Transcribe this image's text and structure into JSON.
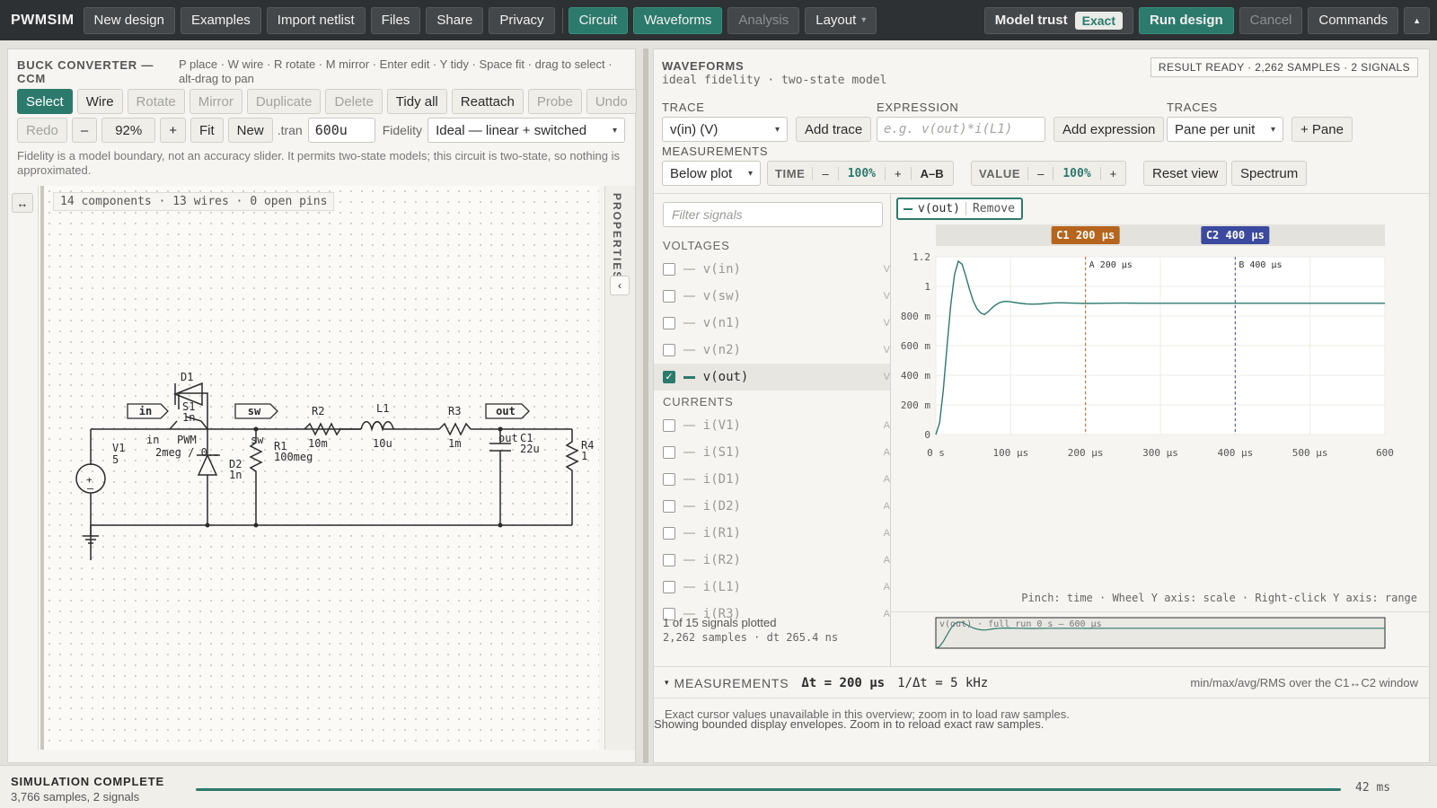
{
  "app": {
    "brand": "PWMSIM",
    "toolbar": {
      "new_design": "New design",
      "examples": "Examples",
      "import_netlist": "Import netlist",
      "files": "Files",
      "share": "Share",
      "privacy": "Privacy",
      "circuit": "Circuit",
      "waveforms": "Waveforms",
      "analysis": "Analysis",
      "layout": "Layout",
      "model_trust": "Model trust",
      "model_trust_value": "Exact",
      "run_design": "Run design",
      "cancel": "Cancel",
      "commands": "Commands"
    },
    "accent_color": "#2c7a6c"
  },
  "editor": {
    "title": "BUCK CONVERTER — CCM",
    "hint": "P place · W wire · R rotate · M mirror · Enter edit · Y tidy · Space fit · drag to select · alt-drag to pan",
    "tools": [
      "Select",
      "Wire",
      "Rotate",
      "Mirror",
      "Duplicate",
      "Delete",
      "Tidy all",
      "Reattach",
      "Probe",
      "Undo"
    ],
    "redo": "Redo",
    "zoom_minus": "–",
    "zoom": "92%",
    "zoom_plus": "+",
    "fit": "Fit",
    "new": "New",
    "tran_label": ".tran",
    "tran_value": "600u",
    "fidelity_label": "Fidelity",
    "fidelity_value": "Ideal — linear + switched",
    "fidelity_note": "Fidelity is a model boundary, not an accuracy slider. It permits two-state models; this circuit is two-state, so nothing is approximated.",
    "counts": "14 components · 13 wires · 0 open pins",
    "properties": "PROPERTIES",
    "expand_icon": "↔",
    "collapse_icon": "‹",
    "schematic": {
      "v1_name": "V1",
      "v1_value": "5",
      "s1_name": "S1",
      "s1_value": "1n",
      "pwm_name": "PWM",
      "pwm_value": "2meg / 0.…",
      "d1_name": "D1",
      "d2_name": "D2",
      "d2_value": "1n",
      "r1_name": "R1",
      "r1_value": "100meg",
      "r2_name": "R2",
      "r2_value": "10m",
      "l1_name": "L1",
      "l1_value": "10u",
      "r3_name": "R3",
      "r3_value": "1m",
      "c1_name": "C1",
      "c1_value": "22u",
      "r4_name": "R4",
      "r4_value": "1",
      "net_in": "in",
      "net_sw": "sw",
      "net_out": "out"
    }
  },
  "waveforms": {
    "title": "WAVEFORMS",
    "subtitle": "ideal fidelity · two-state model",
    "result_badge": "RESULT READY · 2,262 SAMPLES · 2 SIGNALS",
    "trace_label": "TRACE",
    "trace_value": "v(in) (V)",
    "add_trace": "Add trace",
    "expression_label": "EXPRESSION",
    "expression_placeholder": "e.g. v(out)*i(L1)",
    "add_expression": "Add expression",
    "traces_label": "TRACES",
    "traces_value": "Pane per unit",
    "add_pane": "+ Pane",
    "measurements_label": "MEASUREMENTS",
    "measurements_value": "Below plot",
    "time_label": "TIME",
    "time_zoom": "100%",
    "ab": "A–B",
    "value_label": "VALUE",
    "value_zoom": "100%",
    "minus": "–",
    "plus": "+",
    "reset_view": "Reset view",
    "spectrum": "Spectrum",
    "filter_placeholder": "Filter signals",
    "voltages_header": "VOLTAGES",
    "currents_header": "CURRENTS",
    "voltages": [
      {
        "name": "v(in)",
        "unit": "V",
        "checked": false
      },
      {
        "name": "v(sw)",
        "unit": "V",
        "checked": false
      },
      {
        "name": "v(n1)",
        "unit": "V",
        "checked": false
      },
      {
        "name": "v(n2)",
        "unit": "V",
        "checked": false
      },
      {
        "name": "v(out)",
        "unit": "V",
        "checked": true
      }
    ],
    "currents": [
      {
        "name": "i(V1)",
        "unit": "A",
        "checked": false
      },
      {
        "name": "i(S1)",
        "unit": "A",
        "checked": false
      },
      {
        "name": "i(D1)",
        "unit": "A",
        "checked": false
      },
      {
        "name": "i(D2)",
        "unit": "A",
        "checked": false
      },
      {
        "name": "i(R1)",
        "unit": "A",
        "checked": false
      },
      {
        "name": "i(R2)",
        "unit": "A",
        "checked": false
      },
      {
        "name": "i(L1)",
        "unit": "A",
        "checked": false
      },
      {
        "name": "i(R3)",
        "unit": "A",
        "checked": false
      }
    ],
    "plotted_summary": "1 of 15 signals plotted",
    "samples_summary": "2,262 samples · dt 265.4 ns",
    "active_trace": "v(out)",
    "remove": "Remove",
    "cursor_c1": "C1 200 µs",
    "cursor_c2": "C2 400 µs",
    "cursor_a": "A 200 µs",
    "cursor_b": "B 400 µs",
    "plot_hint": "Pinch: time · Wheel Y axis: scale · Right-click Y axis: range",
    "overview_label": "v(out) · full run 0 s – 600 µs",
    "meas_header": "MEASUREMENTS",
    "meas_toggle": "▾",
    "delta_t": "Δt = 200 µs",
    "inv_delta_t": "1/Δt = 5 kHz",
    "meas_window": "min/max/avg/RMS over the C1↔C2 window",
    "meas_note": "Exact cursor values unavailable in this overview; zoom in to load raw samples.",
    "envelope_note": "Showing bounded display envelopes. Zoom in to reload exact raw samples.",
    "cursor_a_color": "#b5651d",
    "cursor_b_color": "#3b4a9e"
  },
  "chart_data": {
    "type": "line",
    "series": [
      {
        "name": "v(out)",
        "x": [
          0,
          5,
          10,
          15,
          20,
          25,
          30,
          35,
          40,
          45,
          50,
          55,
          60,
          65,
          70,
          75,
          80,
          85,
          90,
          95,
          100,
          110,
          120,
          130,
          140,
          150,
          160,
          170,
          180,
          190,
          200,
          225,
          250,
          275,
          300,
          350,
          400,
          450,
          500,
          550,
          600
        ],
        "y": [
          0,
          0.08,
          0.3,
          0.6,
          0.88,
          1.08,
          1.17,
          1.15,
          1.07,
          0.98,
          0.9,
          0.85,
          0.82,
          0.81,
          0.83,
          0.855,
          0.875,
          0.89,
          0.897,
          0.899,
          0.896,
          0.888,
          0.882,
          0.88,
          0.882,
          0.886,
          0.889,
          0.889,
          0.887,
          0.886,
          0.885,
          0.886,
          0.887,
          0.886,
          0.886,
          0.886,
          0.886,
          0.886,
          0.886,
          0.886,
          0.886
        ]
      }
    ],
    "x_ticks": [
      "0 s",
      "100 µs",
      "200 µs",
      "300 µs",
      "400 µs",
      "500 µs",
      "600"
    ],
    "y_ticks": [
      "0",
      "200 m",
      "400 m",
      "600 m",
      "800 m",
      "1",
      "1.2"
    ],
    "xlim": [
      0,
      600
    ],
    "ylim": [
      0,
      1.2
    ],
    "cursors": [
      200,
      400
    ],
    "grid": true
  }
}
